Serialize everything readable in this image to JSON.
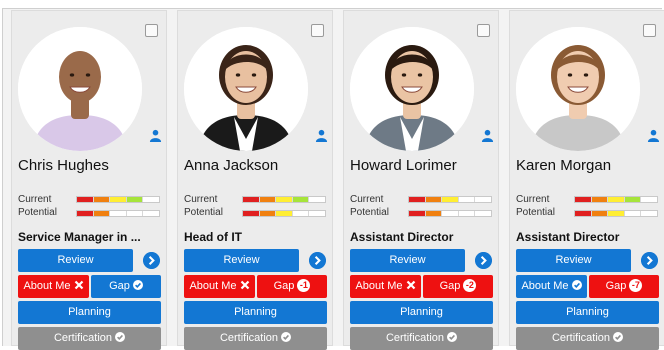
{
  "colors": {
    "blue": "#1377d3",
    "red": "#ee1111",
    "grey": "#8f8f8f",
    "rating": [
      "#e02020",
      "#f08010",
      "#ffee33",
      "#a6e43a",
      "#ffffff"
    ]
  },
  "cards": [
    {
      "name": "Chris Hughes",
      "title": "Service Manager in ...",
      "current_label": "Current",
      "potential_label": "Potential",
      "current_level": 4,
      "potential_level": 2,
      "review_label": "Review",
      "about_label": "About Me",
      "about_status": "x-icon",
      "about_color": "red",
      "gap_label": "Gap",
      "gap_badge": "",
      "gap_status": "check-icon",
      "gap_color": "blue",
      "planning_label": "Planning",
      "certification_label": "Certification",
      "photo": {
        "skin": "#9a6a4a",
        "hair": "none",
        "shirt": "#d9c8e8",
        "dark_suit": false
      }
    },
    {
      "name": "Anna Jackson",
      "title": "Head of IT",
      "current_label": "Current",
      "potential_label": "Potential",
      "current_level": 5,
      "potential_level": 3,
      "review_label": "Review",
      "about_label": "About Me",
      "about_status": "x-icon",
      "about_color": "red",
      "gap_label": "Gap",
      "gap_badge": "-1",
      "gap_status": "",
      "gap_color": "red",
      "planning_label": "Planning",
      "certification_label": "Certification",
      "photo": {
        "skin": "#e8c0a0",
        "hair": "#3a2418",
        "shirt": "#1a1a1a",
        "dark_suit": true
      }
    },
    {
      "name": "Howard Lorimer",
      "title": "Assistant Director",
      "current_label": "Current",
      "potential_label": "Potential",
      "current_level": 3,
      "potential_level": 2,
      "review_label": "Review",
      "about_label": "About Me",
      "about_status": "x-icon",
      "about_color": "red",
      "gap_label": "Gap",
      "gap_badge": "-2",
      "gap_status": "",
      "gap_color": "red",
      "planning_label": "Planning",
      "certification_label": "Certification",
      "photo": {
        "skin": "#eac4a4",
        "hair": "#2a1a10",
        "shirt": "#6e7a86",
        "dark_suit": true
      }
    },
    {
      "name": "Karen Morgan",
      "title": "Assistant Director",
      "current_label": "Current",
      "potential_label": "Potential",
      "current_level": 5,
      "potential_level": 3,
      "review_label": "Review",
      "about_label": "About Me",
      "about_status": "check-icon",
      "about_color": "blue",
      "gap_label": "Gap",
      "gap_badge": "-7",
      "gap_status": "",
      "gap_color": "red",
      "planning_label": "Planning",
      "certification_label": "Certification",
      "photo": {
        "skin": "#f0ccb0",
        "hair": "#8a5a34",
        "shirt": "#c8c8c8",
        "dark_suit": false
      }
    }
  ]
}
